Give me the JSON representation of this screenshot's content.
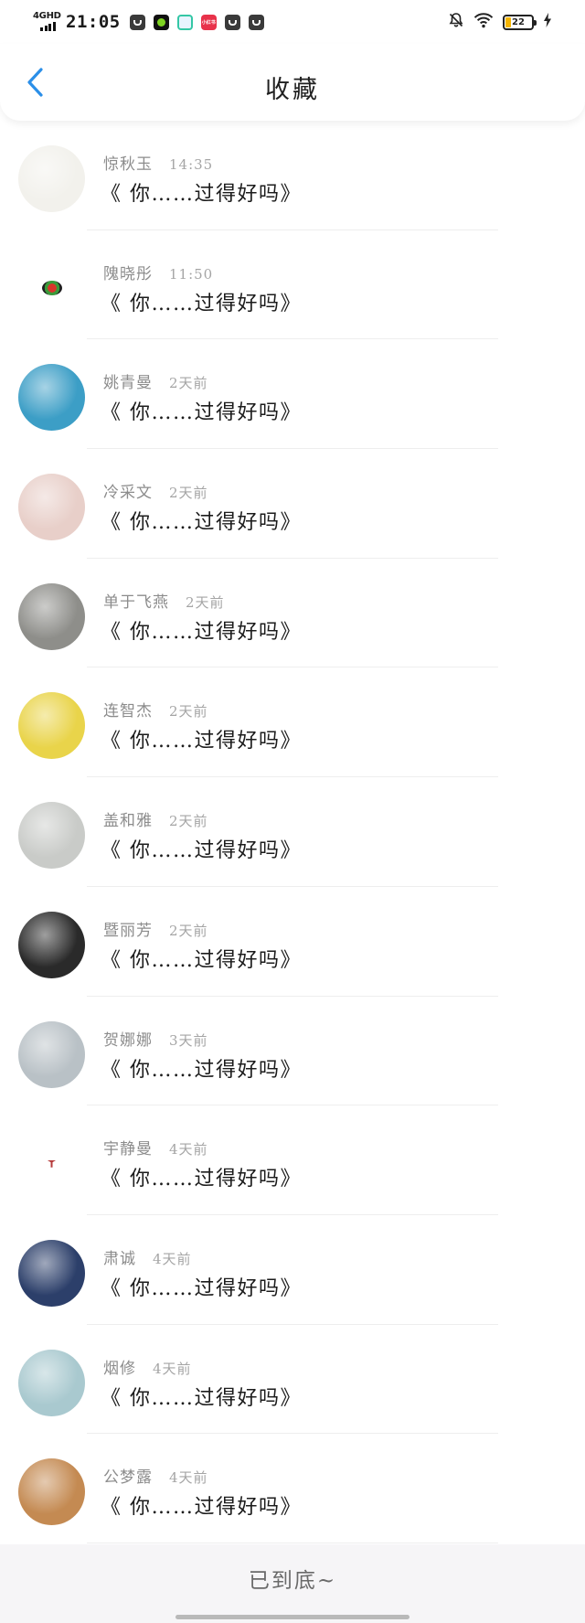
{
  "status_bar": {
    "network": "4GHD",
    "time": "21:05",
    "app_icons": [
      {
        "name": "app-icon-1",
        "color": "#3a3a3a"
      },
      {
        "name": "app-icon-2",
        "color": "#111111"
      },
      {
        "name": "app-icon-3",
        "color": "#e8f4ff"
      },
      {
        "name": "app-icon-4",
        "color": "#e8324a",
        "text": "小红书"
      },
      {
        "name": "app-icon-5",
        "color": "#3a3a3a"
      },
      {
        "name": "app-icon-6",
        "color": "#3a3a3a"
      }
    ],
    "battery_level": "22"
  },
  "header": {
    "title": "收藏"
  },
  "items": [
    {
      "name": "惊秋玉",
      "time": "14:35",
      "title": "《 你……过得好吗》",
      "avatar_color": "#f2f1ec"
    },
    {
      "name": "隗晓彤",
      "time": "11:50",
      "title": "《 你……过得好吗》",
      "avatar_color": "#ffffff"
    },
    {
      "name": "姚青曼",
      "time": "2天前",
      "title": "《 你……过得好吗》",
      "avatar_color": "#3c9ec6"
    },
    {
      "name": "冷采文",
      "time": "2天前",
      "title": "《 你……过得好吗》",
      "avatar_color": "#e8cfc9"
    },
    {
      "name": "单于飞燕",
      "time": "2天前",
      "title": "《 你……过得好吗》",
      "avatar_color": "#8e8e8a"
    },
    {
      "name": "连智杰",
      "time": "2天前",
      "title": "《 你……过得好吗》",
      "avatar_color": "#e9d44a"
    },
    {
      "name": "盖和雅",
      "time": "2天前",
      "title": "《 你……过得好吗》",
      "avatar_color": "#c9cbc8"
    },
    {
      "name": "暨丽芳",
      "time": "2天前",
      "title": "《 你……过得好吗》",
      "avatar_color": "#2a2a2a"
    },
    {
      "name": "贺娜娜",
      "time": "3天前",
      "title": "《 你……过得好吗》",
      "avatar_color": "#b9c1c6"
    },
    {
      "name": "宇静曼",
      "time": "4天前",
      "title": "《 你……过得好吗》",
      "avatar_color": "#ffffff"
    },
    {
      "name": "肃诚",
      "time": "4天前",
      "title": "《 你……过得好吗》",
      "avatar_color": "#2c3f6a"
    },
    {
      "name": "烟修",
      "time": "4天前",
      "title": "《 你……过得好吗》",
      "avatar_color": "#a9c9cf"
    },
    {
      "name": "公梦露",
      "time": "4天前",
      "title": "《 你……过得好吗》",
      "avatar_color": "#c48a52"
    }
  ],
  "footer": {
    "end_text": "已到底~"
  },
  "colors": {
    "accent": "#2b8fe8",
    "footer_bg": "#f6f5f7"
  }
}
